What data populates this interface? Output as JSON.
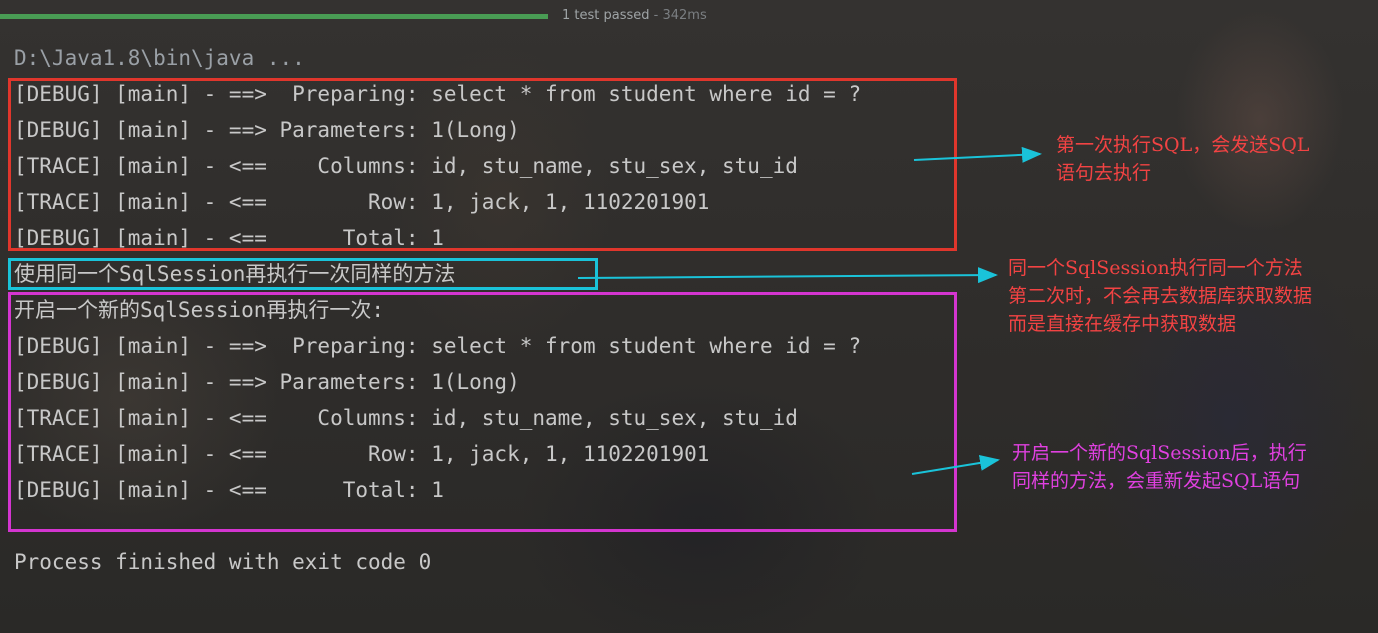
{
  "test_bar": {
    "progress": 1.0,
    "status": "1 test passed",
    "separator": " - ",
    "duration": "342ms"
  },
  "console": {
    "command": "D:\\Java1.8\\bin\\java ...",
    "block1": [
      "[DEBUG] [main] - ==>  Preparing: select * from student where id = ?",
      "[DEBUG] [main] - ==> Parameters: 1(Long)",
      "[TRACE] [main] - <==    Columns: id, stu_name, stu_sex, stu_id",
      "[TRACE] [main] - <==        Row: 1, jack, 1, 1102201901",
      "[DEBUG] [main] - <==      Total: 1"
    ],
    "same_session_msg": "使用同一个SqlSession再执行一次同样的方法",
    "new_session_msg": "开启一个新的SqlSession再执行一次:",
    "block2": [
      "[DEBUG] [main] - ==>  Preparing: select * from student where id = ?",
      "[DEBUG] [main] - ==> Parameters: 1(Long)",
      "[TRACE] [main] - <==    Columns: id, stu_name, stu_sex, stu_id",
      "[TRACE] [main] - <==        Row: 1, jack, 1, 1102201901",
      "[DEBUG] [main] - <==      Total: 1"
    ],
    "exit_msg": "Process finished with exit code 0"
  },
  "annotations": {
    "note1": "第一次执行SQL，会发送SQL\n语句去执行",
    "note2": "同一个SqlSession执行同一个方法\n第二次时，不会再去数据库获取数据\n而是直接在缓存中获取数据",
    "note3": "开启一个新的SqlSession后，执行\n同样的方法，会重新发起SQL语句"
  },
  "colors": {
    "box_first": "#e0362c",
    "box_same_session": "#1ac3d9",
    "box_new_session": "#d435d0",
    "arrow": "#1ac3d9"
  }
}
